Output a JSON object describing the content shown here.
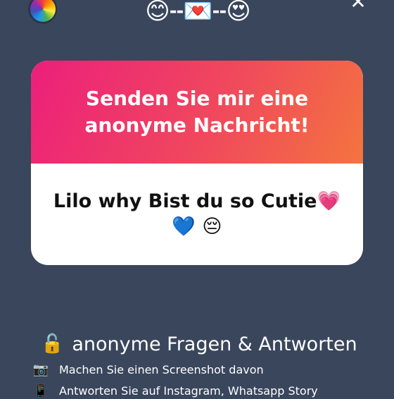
{
  "header": {
    "emoji_left": "😊",
    "dashes_1": "--",
    "emoji_mid": "💌",
    "dashes_2": "--",
    "emoji_right": "😍",
    "close_symbol": "✕"
  },
  "card": {
    "title": "Senden Sie mir eine anonyme Nachricht!",
    "message": "Lilo why Bist du so Cutie💗💙 😔"
  },
  "features": {
    "title_icon": "🔓",
    "title": "anonyme Fragen & Antworten",
    "items": [
      {
        "icon": "📷",
        "text": "Machen Sie einen Screenshot davon"
      },
      {
        "icon": "📱",
        "text": "Antworten Sie auf Instagram, Whatsapp Story"
      }
    ]
  },
  "colors": {
    "background": "#39465c",
    "gradient_start": "#ec1f7b",
    "gradient_end": "#f4743f"
  },
  "icons": [
    "color-wheel-icon",
    "close-icon",
    "unlock-icon",
    "camera-icon",
    "phone-icon"
  ]
}
